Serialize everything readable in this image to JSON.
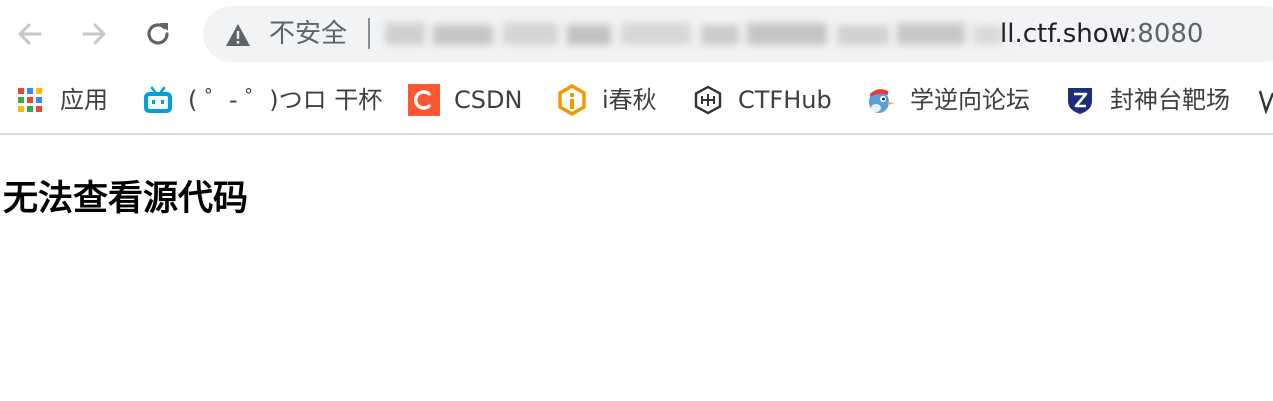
{
  "colors": {
    "toolbar_bg": "#ffffff",
    "omnibox_bg": "#f1f3f4",
    "icon_gray": "#5f6368",
    "csdn_red": "#fc5531",
    "bilibili_blue": "#00a1d6",
    "ichunqiu_orange": "#f39800",
    "fengshentai_navy": "#1d2d7a"
  },
  "toolbar": {
    "back_icon": "arrow-left-icon",
    "forward_icon": "arrow-right-icon",
    "reload_icon": "reload-icon",
    "omnibox": {
      "security_icon": "warning-icon",
      "security_label": "不安全",
      "url_visible_text": "ll.ctf.show",
      "url_port": ":8080"
    }
  },
  "bookmarks": [
    {
      "label": "应用",
      "icon": "apps-grid-icon"
    },
    {
      "label": "( ゜- ゜)つロ 干杯",
      "icon": "bilibili-tv-icon"
    },
    {
      "label": "CSDN",
      "icon": "csdn-icon"
    },
    {
      "label": "i春秋",
      "icon": "ichunqiu-icon"
    },
    {
      "label": "CTFHub",
      "icon": "ctfhub-icon"
    },
    {
      "label": "学逆向论坛",
      "icon": "bird-icon"
    },
    {
      "label": "封神台靶场",
      "icon": "fengshentai-shield-icon"
    }
  ],
  "page": {
    "heading": "无法查看源代码"
  }
}
